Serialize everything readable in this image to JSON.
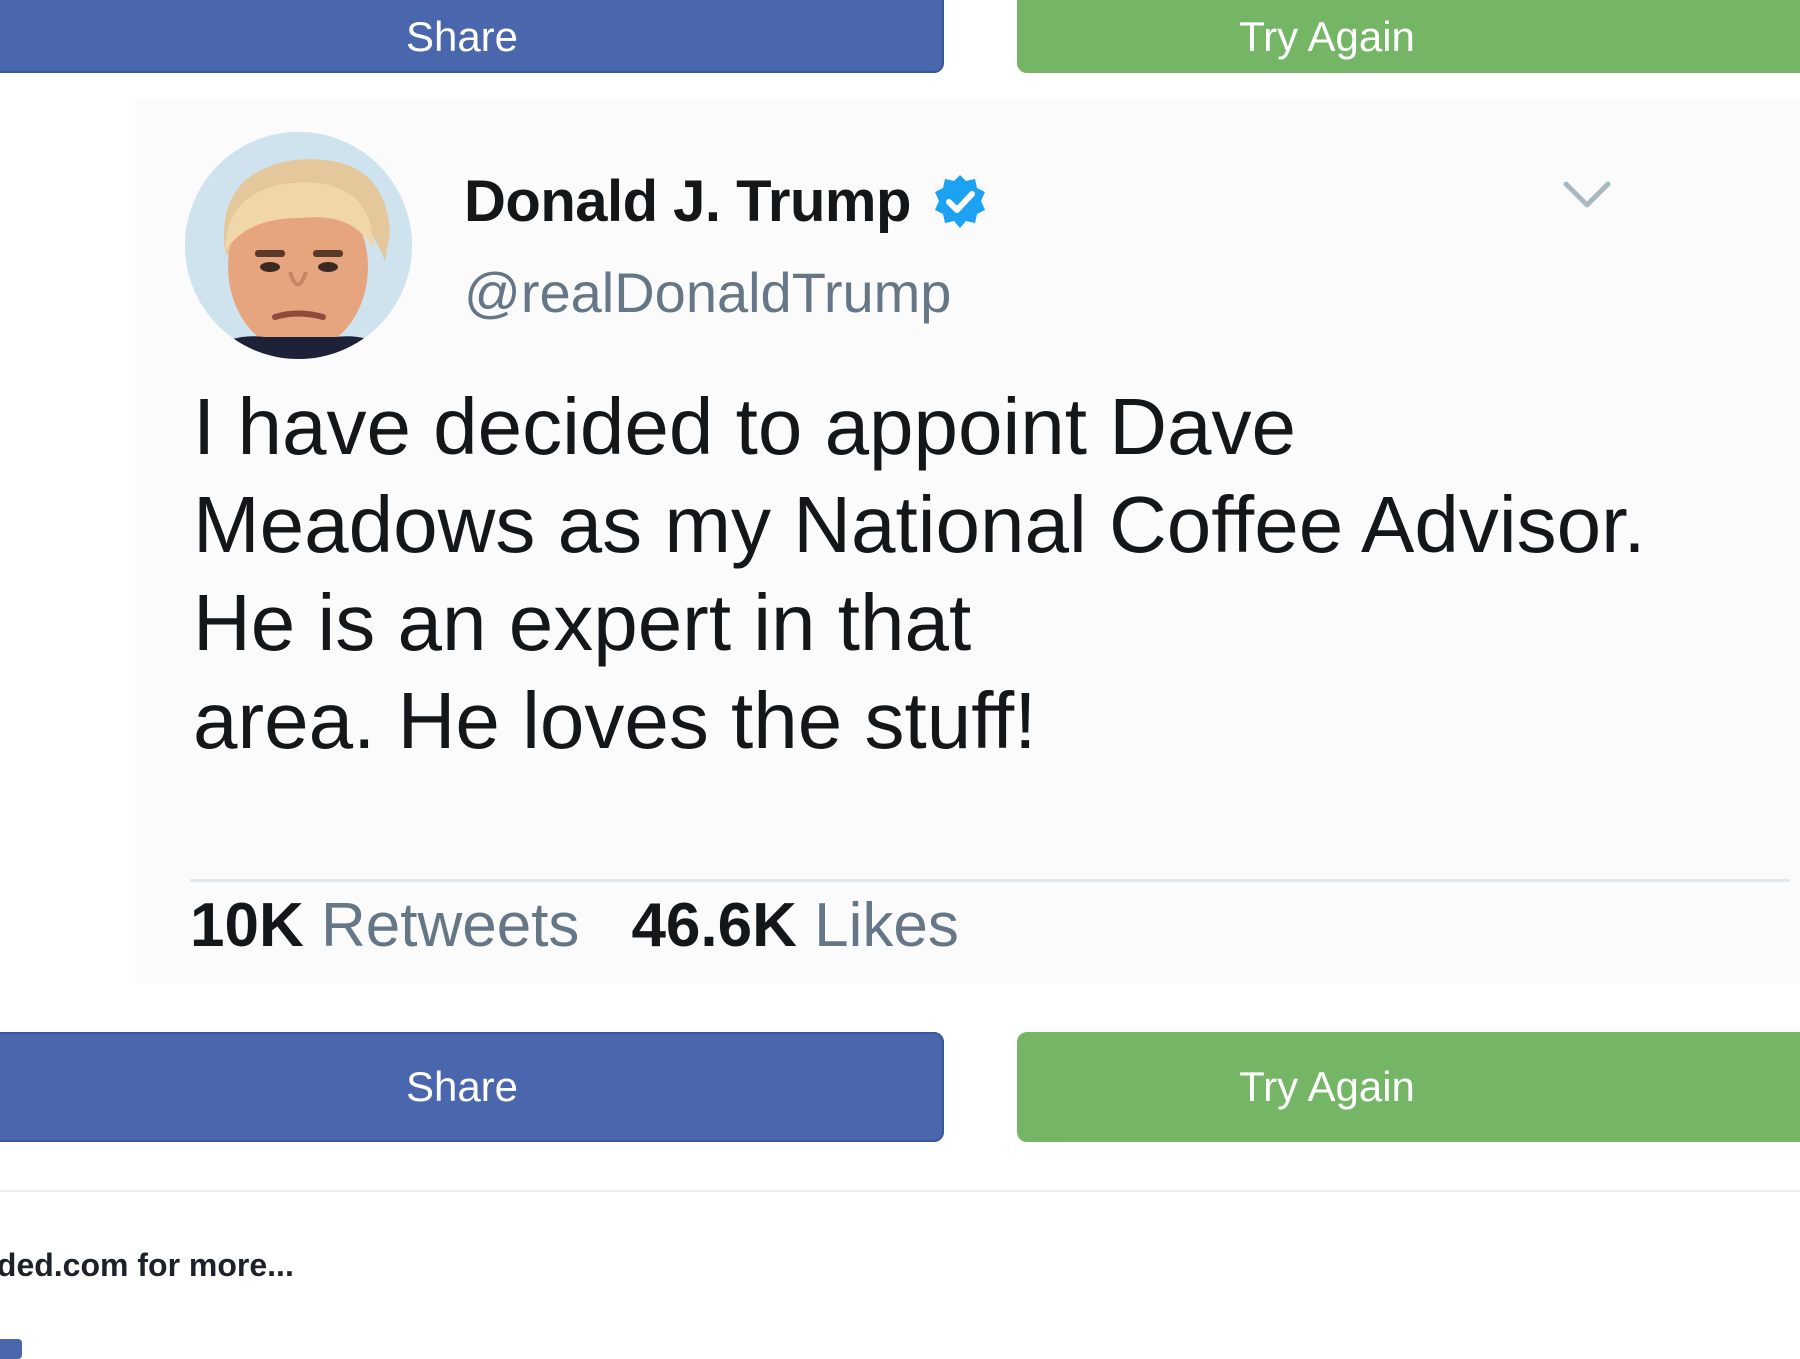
{
  "buttons": {
    "share_label": "Share",
    "try_again_label": "Try Again"
  },
  "tweet": {
    "display_name": "Donald J. Trump",
    "handle": "@realDonaldTrump",
    "verified": true,
    "text_lines": [
      "I have decided to appoint Dave",
      "Meadows as my National Coffee Advisor.",
      "He is an expert in that",
      "area. He loves the stuff!"
    ],
    "retweets_count": "10K",
    "retweets_label": "Retweets",
    "likes_count": "46.6K",
    "likes_label": "Likes"
  },
  "footer": {
    "text": "ided.com for more..."
  },
  "colors": {
    "share": "#4a66ad",
    "try_again": "#74b566",
    "verified": "#1da1f2"
  }
}
